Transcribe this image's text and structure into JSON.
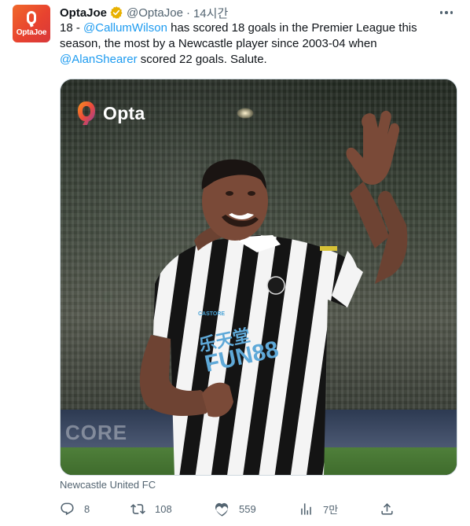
{
  "tweet": {
    "display_name": "OptaJoe",
    "handle": "@OptaJoe",
    "separator": "·",
    "time": "14시간",
    "avatar_text": "OptaJoe",
    "text": {
      "part1": "18 - ",
      "mention1": "@CallumWilson",
      "part2": " has scored 18 goals in the Premier League this season, the most by a Newcastle player since 2003-04 when ",
      "mention2": "@AlanShearer",
      "part3": " scored 22 goals. Salute."
    },
    "media": {
      "logo_text": "Opta",
      "shirt_sponsor_top": "乐天堂",
      "shirt_sponsor": "FUN88",
      "shirt_brand": "CASTORE",
      "ad_board_text": "CORE"
    },
    "caption": "Newcastle United FC",
    "actions": {
      "replies": "8",
      "retweets": "108",
      "likes": "559",
      "views": "7만"
    }
  },
  "colors": {
    "accent": "#1d9bf0",
    "secondary_text": "#536471",
    "verified_badge": "#e8b100",
    "brand_orange": "#f0682a"
  },
  "icons": [
    "opta-logo-icon",
    "verified-badge-icon",
    "more-icon",
    "reply-icon",
    "retweet-icon",
    "like-icon",
    "views-icon",
    "share-icon"
  ]
}
